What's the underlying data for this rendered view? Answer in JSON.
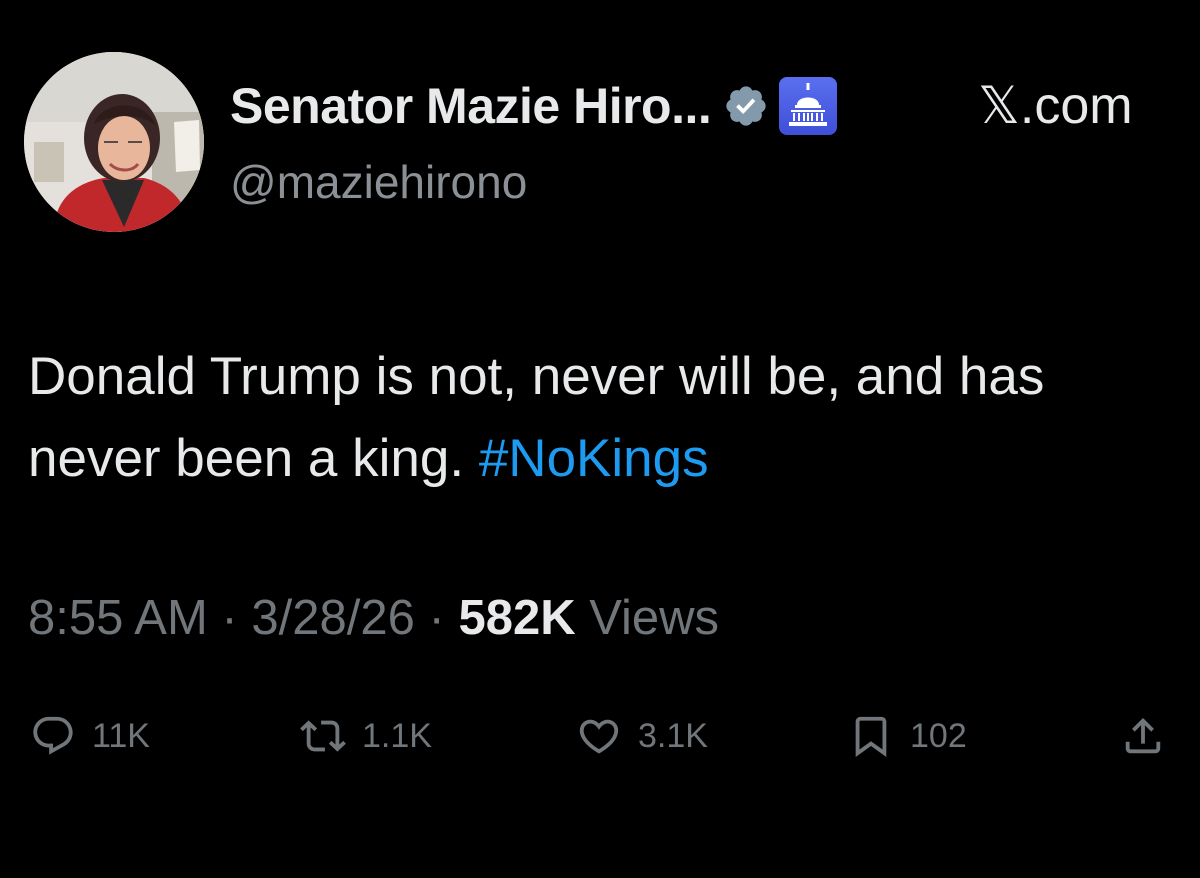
{
  "author": {
    "display_name": "Senator Mazie Hiro...",
    "handle": "@maziehirono",
    "verified_icon": "verified-badge-icon",
    "affiliation_icon": "capitol-dome-icon"
  },
  "source": {
    "label": "𝕏.com"
  },
  "tweet": {
    "text": "Donald Trump is not, never will be, and has never been a king.",
    "hashtag": "#NoKings"
  },
  "meta": {
    "time": "8:55 AM",
    "separator": "·",
    "date": "3/28/26",
    "views_count": "582K",
    "views_label": "Views"
  },
  "actions": {
    "replies": "11K",
    "reposts": "1.1K",
    "likes": "3.1K",
    "bookmarks": "102"
  },
  "colors": {
    "background": "#000000",
    "text": "#e7e9ea",
    "muted": "#71767b",
    "accent": "#1d9bf0"
  }
}
